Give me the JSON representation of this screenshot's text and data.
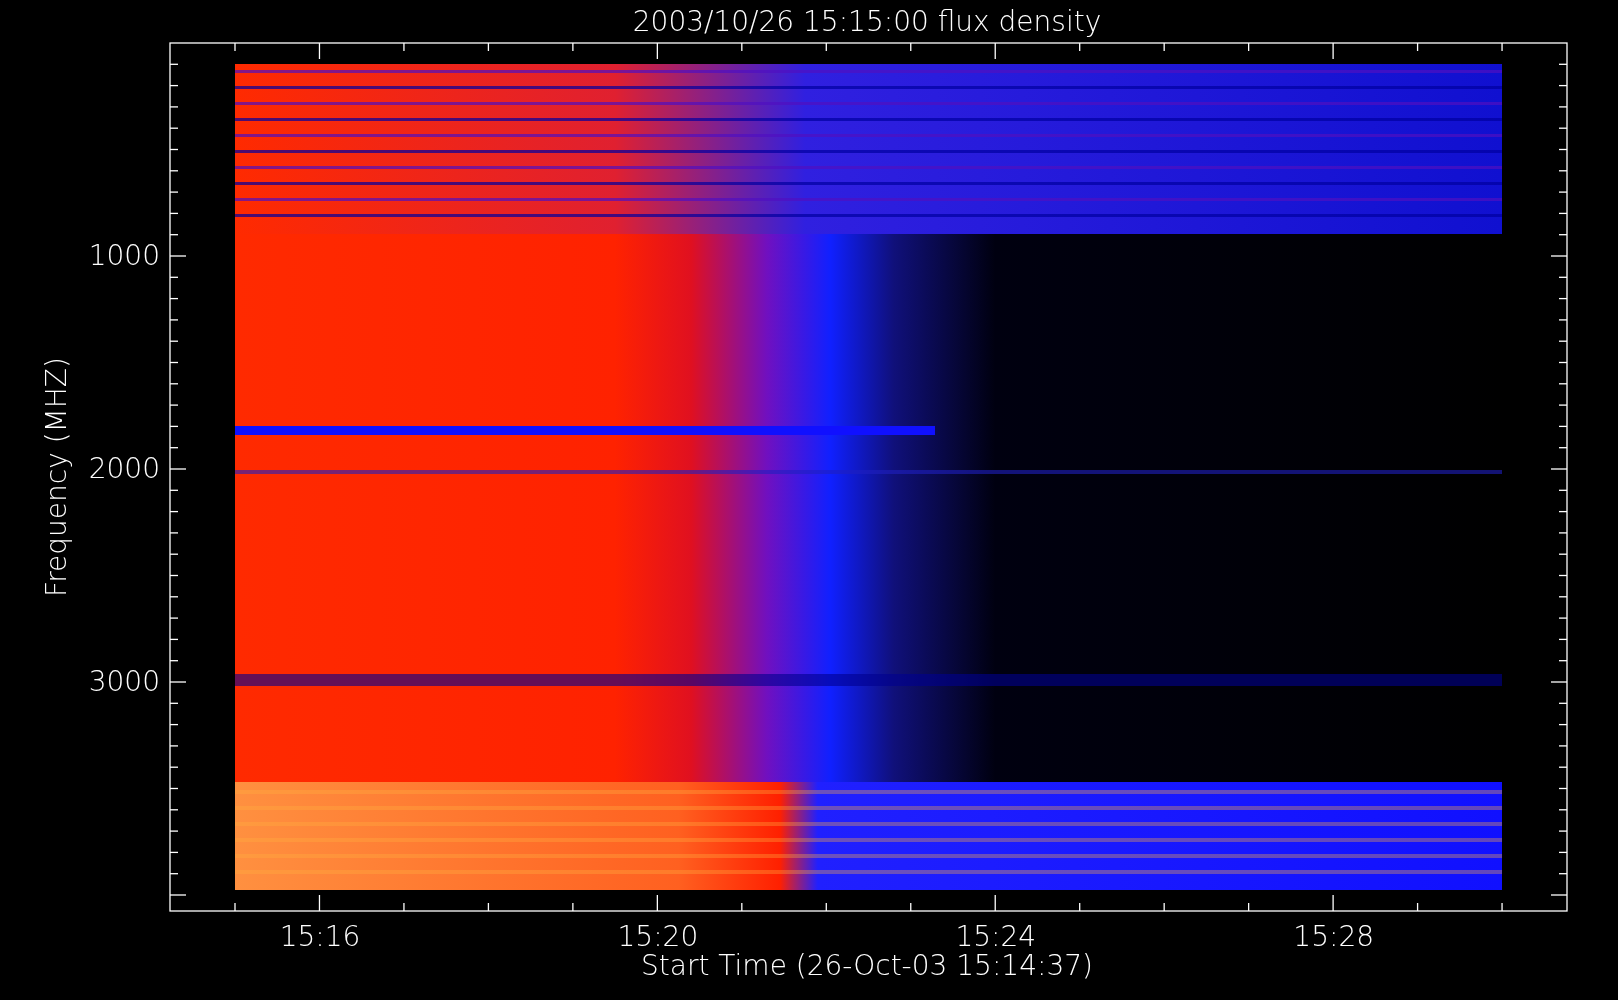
{
  "title": "2003/10/26 15:15:00 flux density",
  "y_axis": {
    "label": "Frequency (MHZ)",
    "ticks": [
      "1000",
      "2000",
      "3000"
    ]
  },
  "x_axis": {
    "label": "Start Time (26-Oct-03 15:14:37)",
    "ticks": [
      "15:16",
      "15:20",
      "15:24",
      "15:28"
    ]
  }
}
